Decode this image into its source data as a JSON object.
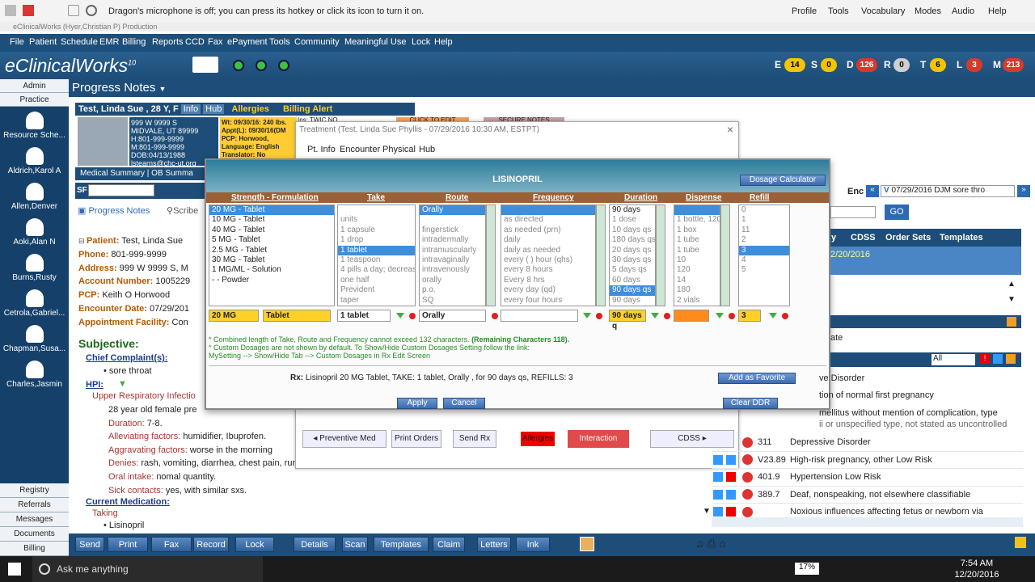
{
  "dragon": {
    "message": "Dragon's microphone is off; you can press its hotkey or click its icon to turn it on.",
    "menu": [
      "Profile",
      "Tools",
      "Vocabulary",
      "Modes",
      "Audio",
      "Help"
    ]
  },
  "window_title": "eClinicalWorks (Hyer,Christian P)  Production",
  "menu": [
    "File",
    "Patient",
    "Schedule",
    "EMR",
    "Billing",
    "Reports",
    "CCD",
    "Fax",
    "ePayment",
    "Tools",
    "Community",
    "Meaningful Use",
    "Lock",
    "Help"
  ],
  "brand": "eClinicalWorks",
  "brand_version": "10",
  "status": [
    {
      "letter": "E",
      "count": "14",
      "color": "#f5c400",
      "text": "#000"
    },
    {
      "letter": "S",
      "count": "0",
      "color": "#f5c400",
      "text": "#000"
    },
    {
      "letter": "D",
      "count": "126",
      "color": "#d83a2a",
      "text": "#fff"
    },
    {
      "letter": "R",
      "count": "0",
      "color": "#cfcfcf",
      "text": "#000"
    },
    {
      "letter": "T",
      "count": "6",
      "color": "#f5c400",
      "text": "#000"
    },
    {
      "letter": "L",
      "count": "3",
      "color": "#d83a2a",
      "text": "#fff"
    },
    {
      "letter": "M",
      "count": "213",
      "color": "#d83a2a",
      "text": "#fff"
    }
  ],
  "sidebar": {
    "tabs": [
      "Admin",
      "Practice"
    ],
    "users": [
      "Resource Sche...",
      "Aldrich,Karol A",
      "Allen,Denver",
      "Aoki,Alan N",
      "Burns,Rusty",
      "Cetrola,Gabriel...",
      "Chapman,Susa...",
      "Charles,Jasmin"
    ],
    "bottom_tabs": [
      "Registry",
      "Referrals",
      "Messages",
      "Documents",
      "Billing"
    ]
  },
  "progress_notes": {
    "title": "Progress Notes",
    "patient_header": "Test, Linda Sue , 28 Y, F",
    "info_tag": "Info",
    "hub_tag": "Hub",
    "allergies": "Allergies",
    "billing_alert": "Billing Alert",
    "address_block": [
      "999 W 9999 S",
      "MIDVALE, UT 89999",
      "H:801-999-9999",
      "M:801-999-9999",
      "DOB:04/13/1988",
      "lstearns@chc-ut.org"
    ],
    "vitals_block": [
      "Wt: 09/30/16: 240 lbs.",
      "Appt(L): 09/30/16(DM",
      "PCP:       Horwood,",
      "Language:  English",
      "Translator: No"
    ],
    "ins_label": "Ins:",
    "ins_value": "TWIC NO",
    "click_to_edit": "CLICK TO EDIT",
    "secure_notes": "SECURE NOTES",
    "med_summary": "Medical Summary | OB Summa",
    "sf_label": "SF",
    "tab_progress": "Progress Notes",
    "tab_scribe": "Scribe",
    "fields": [
      {
        "label": "Patient:",
        "value": "Test, Linda Sue"
      },
      {
        "label": "Phone:",
        "value": "801-999-9999"
      },
      {
        "label": "Address:",
        "value": "999 W 9999 S, M"
      },
      {
        "label": "Account Number:",
        "value": "1005229"
      },
      {
        "label": "PCP:",
        "value": "Keith O Horwood"
      },
      {
        "label": "Encounter Date:",
        "value": "07/29/201"
      },
      {
        "label": "Appointment Facility:",
        "value": "Con"
      }
    ],
    "subjective": "Subjective:",
    "chief_complaint": "Chief Complaint(s):",
    "cc_item": "sore throat",
    "hpi": "HPI:",
    "hpi_title": "Upper Respiratory Infectio",
    "hpi_lines": [
      {
        "label": "",
        "value": "28 year old female pre"
      },
      {
        "label": "Duration:",
        "value": "7-8."
      },
      {
        "label": "Alleviating factors:",
        "value": "humidifier, Ibuprofen."
      },
      {
        "label": "Aggravating factors:",
        "value": "worse in the morning"
      },
      {
        "label": "Denies:",
        "value": "rash, vomiting, diarrhea, chest pain, runny nose, sleepiness, irritability."
      },
      {
        "label": "Oral intake:",
        "value": "nomal quantity."
      },
      {
        "label": "Sick contacts:",
        "value": "yes, with similar sxs."
      }
    ],
    "current_medication": "Current Medication:",
    "taking": "Taking",
    "med_item": "Lisinopril"
  },
  "treatment": {
    "title": "Treatment (Test, Linda Sue Phyllis - 07/29/2016 10:30 AM, ESTPT)",
    "tabs": [
      "Pt. Info",
      "Encounter",
      "Physical",
      "Hub"
    ],
    "bottom_buttons": [
      "Preventive Med",
      "Print Orders",
      "Send Rx",
      "Allergies",
      "Interaction",
      "CDSS"
    ]
  },
  "rx": {
    "title": "LISINOPRIL",
    "dosage_calc": "Dosage Calculator",
    "columns": [
      "Strength - Formulation",
      "Take",
      "Route",
      "Frequency",
      "Duration",
      "Dispense",
      "Refill"
    ],
    "strength": [
      "20 MG - Tablet",
      "10 MG - Tablet",
      "40 MG - Tablet",
      "5 MG - Tablet",
      "2.5 MG - Tablet",
      "30 MG - Tablet",
      "1 MG/ML - Solution",
      "- - Powder"
    ],
    "take": [
      "",
      "units",
      "1 capsule",
      "1 drop",
      "1 tablet",
      "1 teaspoon",
      "4 pills a day; decreas",
      "one half",
      "Prevident",
      "taper"
    ],
    "route": [
      "Orally",
      "",
      "fingerstick",
      "intradermally",
      "intramuscularly",
      "intravaginally",
      "intravenously",
      "orally",
      "p.o.",
      "SQ"
    ],
    "frequency": [
      "",
      "as directed",
      "as needed (prn)",
      "daily",
      "daily as needed",
      "every ( ) hour (qhs)",
      "every 8 hours",
      "Every 8 hrs",
      "every day (qd)",
      "every four hours"
    ],
    "duration": [
      "90 days",
      "1 dose",
      "10 days qs",
      "180 days qs",
      "20 days qs",
      "30 days qs",
      "5 days qs",
      "60 days",
      "90 days qs",
      "90 days"
    ],
    "dispense": [
      "",
      "1 bottle, 120",
      "1 box",
      "1 tube",
      "1 tube",
      "10",
      "120",
      "14",
      "180",
      "2 vials"
    ],
    "refill": [
      "0",
      "1",
      "11",
      "2",
      "3",
      "4",
      "5"
    ],
    "values": {
      "strength": "20 MG",
      "formulation": "Tablet",
      "take": "1 tablet",
      "route": "Orally",
      "frequency": "",
      "duration": "90 days q",
      "dispense": "",
      "refill": "3"
    },
    "notes": [
      "* Combined length of Take, Route and Frequency cannot exceed 132 characters.",
      "(Remaining Characters 118).",
      "* Custom Dosages are not shown by default. To Show/Hide Custom Dosages Setting follow the link:",
      "MySetting --> Show/Hide Tab --> Custom Dosages in Rx Edit Screen"
    ],
    "summary_prefix": "Rx:",
    "summary_text": "Lisinopril 20 MG Tablet, TAKE: 1 tablet, Orally , for 90 days qs, REFILLS: 3",
    "add_favorite": "Add as Favorite",
    "apply": "Apply",
    "cancel": "Cancel",
    "clear_ddr": "Clear DDR"
  },
  "right_panel": {
    "enc_label": "Enc",
    "enc_value": "07/29/2016 DJM sore thro",
    "go": "GO",
    "tabs": [
      "y",
      "CDSS",
      "Order Sets",
      "Templates"
    ],
    "date": "2/20/2016",
    "ate": "ate",
    "filter": "All",
    "top_rows": [
      "ve Disorder",
      "tion of normal first pregnancy",
      "mellitus without mention of complication, type",
      "ii or unspecified type, not stated as uncontrolled"
    ],
    "dx_rows": [
      {
        "code": "311",
        "desc": "Depressive Disorder"
      },
      {
        "code": "V23.89",
        "desc": "High-risk pregnancy, other Low Risk"
      },
      {
        "code": "401.9",
        "desc": "Hypertension Low Risk"
      },
      {
        "code": "389.7",
        "desc": "Deaf, nonspeaking, not elsewhere classifiable"
      },
      {
        "code": "",
        "desc": "Noxious influences affecting fetus or newborn via"
      }
    ]
  },
  "bottom_toolbar": [
    "Send",
    "Print",
    "Fax",
    "Record",
    "Lock",
    "Details",
    "Scan",
    "Templates",
    "Claim",
    "Letters",
    "Ink"
  ],
  "taskbar": {
    "search": "Ask me anything",
    "battery": "17%",
    "time": "7:54 AM",
    "date": "12/20/2016"
  }
}
